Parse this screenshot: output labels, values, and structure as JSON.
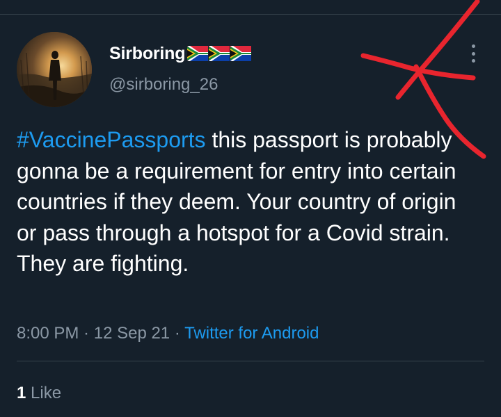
{
  "tweet": {
    "author": {
      "display_name": "Sirboring",
      "handle": "@sirboring_26",
      "flag_icons": [
        "south-africa-flag-icon",
        "south-africa-flag-icon",
        "south-africa-flag-icon"
      ]
    },
    "text": {
      "hashtag": "#VaccinePassports",
      "body": " this passport is probably gonna be a requirement for entry into certain countries if they deem. Your country of origin or pass through a hotspot for a Covid strain. They are fighting."
    },
    "meta": {
      "time": "8:00 PM",
      "separator": " · ",
      "date": "12 Sep 21",
      "source": "Twitter for Android"
    },
    "stats": {
      "likes_count": "1",
      "likes_label": " Like"
    }
  },
  "colors": {
    "background": "#15202b",
    "text": "#ffffff",
    "muted": "#8b98a5",
    "accent": "#1d9bf0",
    "divider": "#38444d",
    "annotation": "#e8252e"
  },
  "icons": {
    "more": "more-vertical-icon"
  }
}
